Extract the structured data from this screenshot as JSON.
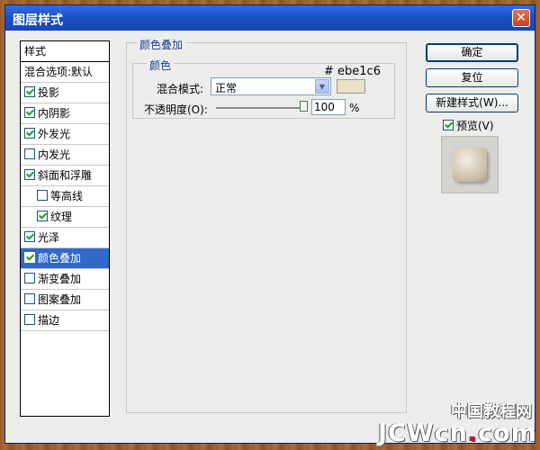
{
  "window": {
    "title": "图层样式",
    "close_glyph": "✕"
  },
  "style_list": {
    "header": "样式",
    "blend_options": "混合选项:默认",
    "items": [
      {
        "label": "投影",
        "checked": true,
        "indent": false,
        "selected": false
      },
      {
        "label": "内阴影",
        "checked": true,
        "indent": false,
        "selected": false
      },
      {
        "label": "外发光",
        "checked": true,
        "indent": false,
        "selected": false
      },
      {
        "label": "内发光",
        "checked": false,
        "indent": false,
        "selected": false
      },
      {
        "label": "斜面和浮雕",
        "checked": true,
        "indent": false,
        "selected": false
      },
      {
        "label": "等高线",
        "checked": false,
        "indent": true,
        "selected": false
      },
      {
        "label": "纹理",
        "checked": true,
        "indent": true,
        "selected": false
      },
      {
        "label": "光泽",
        "checked": true,
        "indent": false,
        "selected": false
      },
      {
        "label": "颜色叠加",
        "checked": true,
        "indent": false,
        "selected": true
      },
      {
        "label": "渐变叠加",
        "checked": false,
        "indent": false,
        "selected": false
      },
      {
        "label": "图案叠加",
        "checked": false,
        "indent": false,
        "selected": false
      },
      {
        "label": "描边",
        "checked": false,
        "indent": false,
        "selected": false
      }
    ]
  },
  "color_overlay": {
    "section_title": "颜色叠加",
    "group_title": "颜色",
    "hex_value": "# ebe1c6",
    "swatch_color": "#ebe1c6",
    "blend_mode_label": "混合模式:",
    "blend_mode_value": "正常",
    "opacity_label": "不透明度(O):",
    "opacity_value": "100",
    "opacity_unit": "%",
    "opacity_fraction": 1.0
  },
  "buttons": {
    "ok": "确定",
    "reset": "复位",
    "new_style": "新建样式(W)...",
    "preview": "预览(V)",
    "preview_checked": true
  },
  "watermark": {
    "cn": "中国教程网",
    "en": "JCWcn",
    "dot": ".",
    "tld": "com"
  }
}
